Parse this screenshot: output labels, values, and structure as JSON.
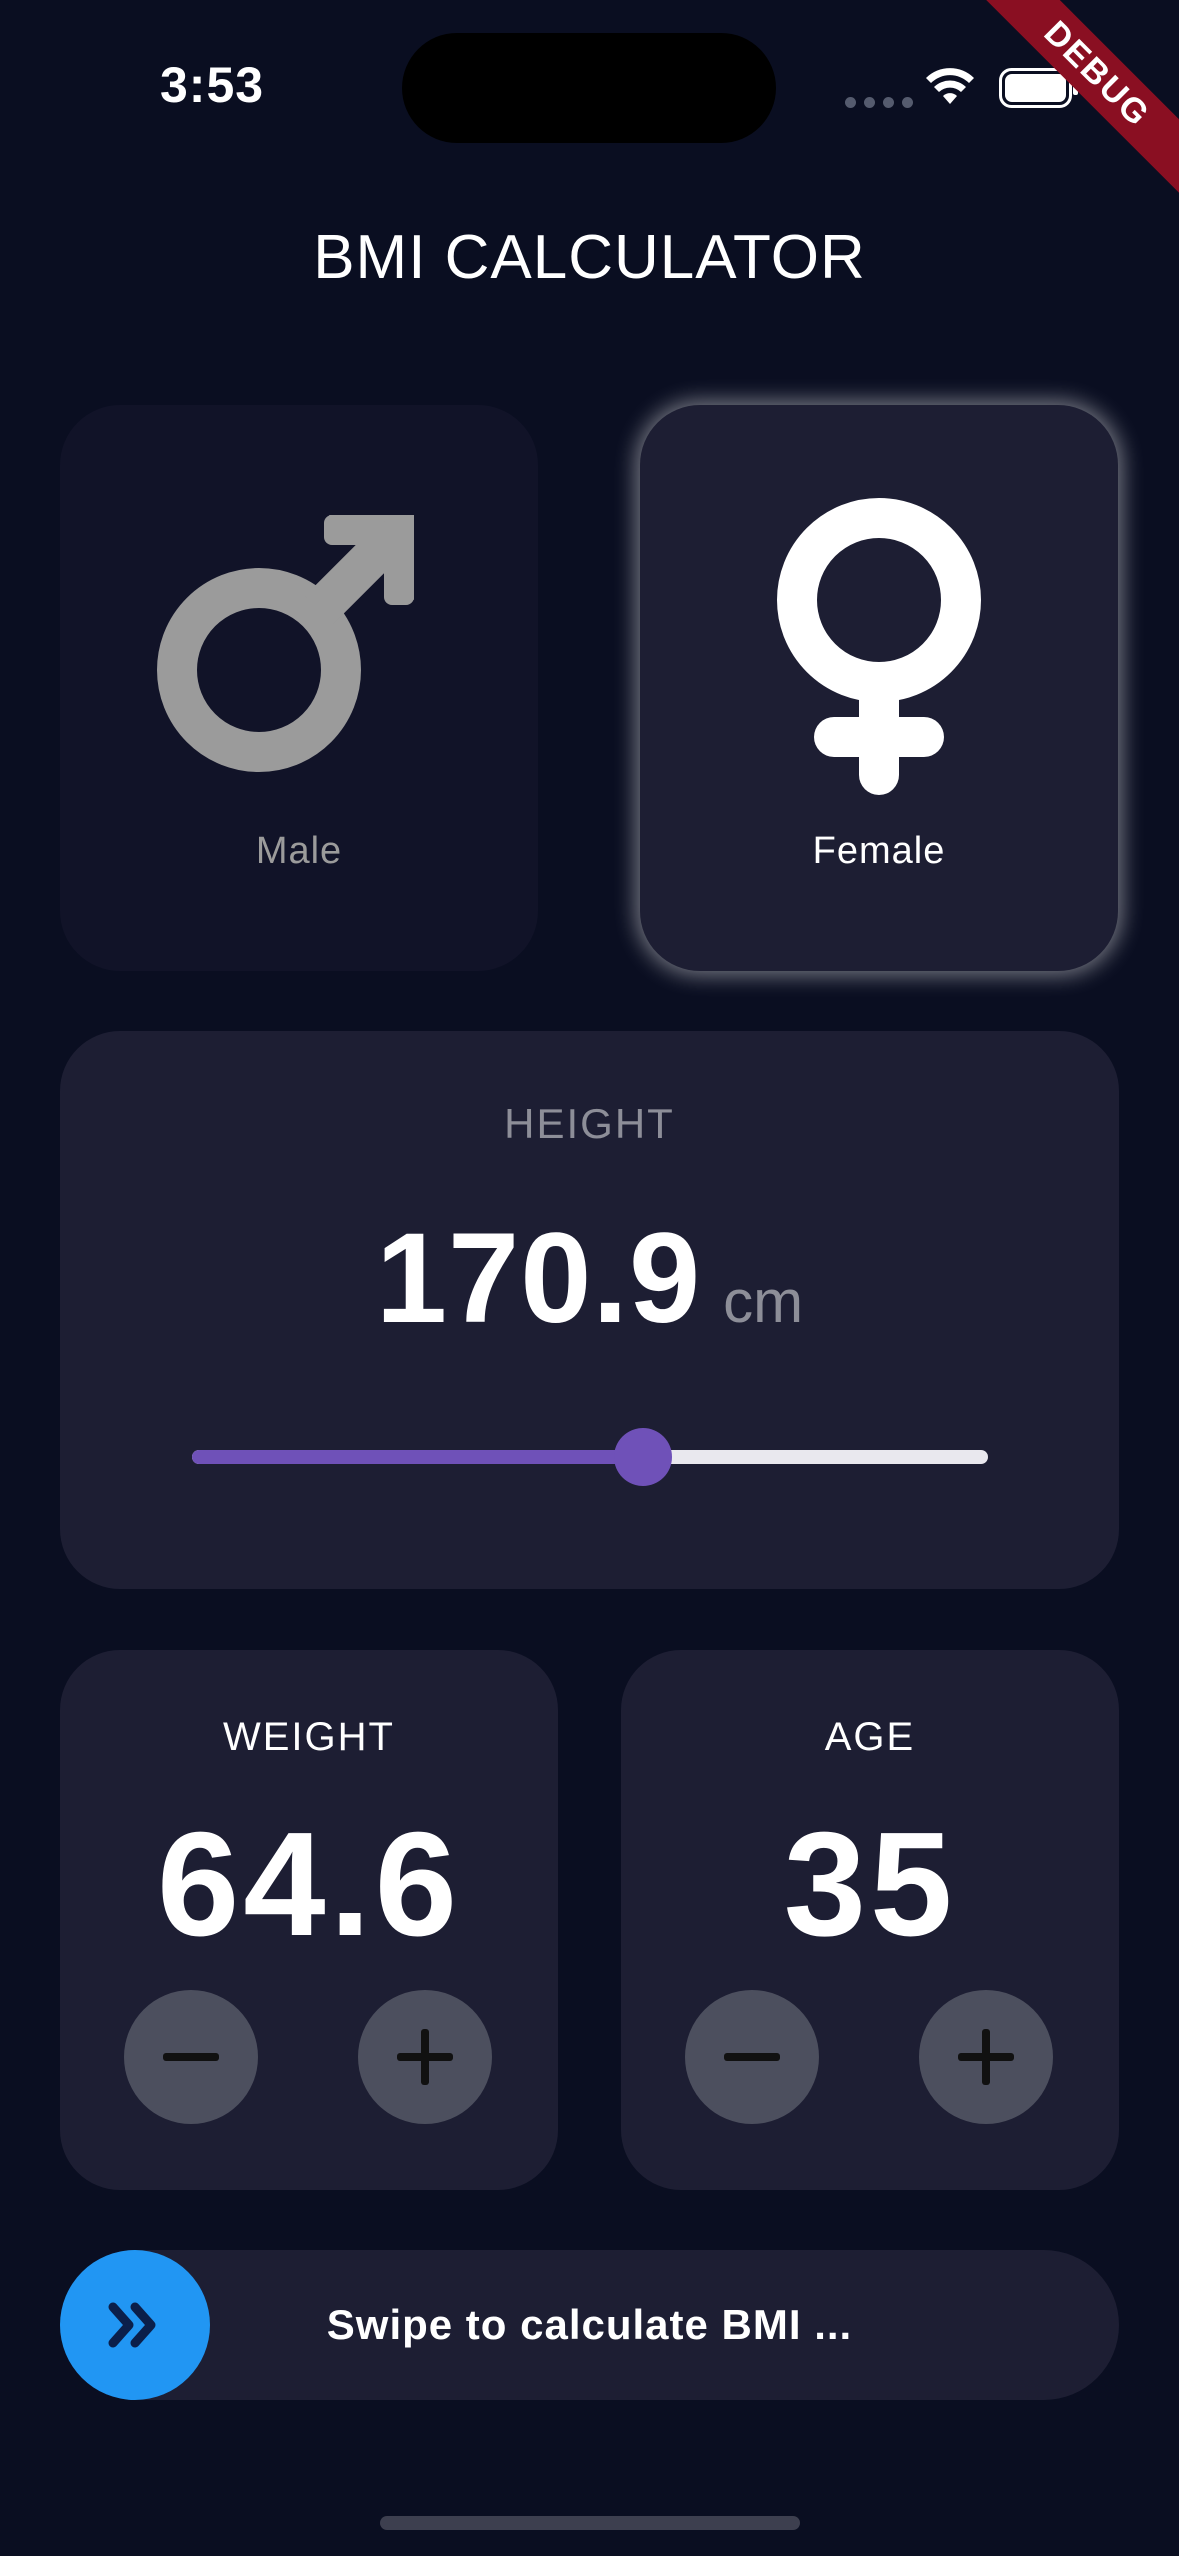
{
  "status_bar": {
    "time": "3:53",
    "wifi_icon": "wifi-icon",
    "battery_icon": "battery-icon"
  },
  "debug_banner": "DEBUG",
  "app_title": "BMI CALCULATOR",
  "gender": {
    "male": {
      "label": "Male",
      "icon": "male-symbol-icon",
      "selected": false,
      "color": "#9b9b9b"
    },
    "female": {
      "label": "Female",
      "icon": "female-symbol-icon",
      "selected": true,
      "color": "#ffffff"
    }
  },
  "height": {
    "label": "HEIGHT",
    "value": "170.9",
    "unit": "cm",
    "slider_fraction": 0.567
  },
  "weight": {
    "label": "WEIGHT",
    "value": "64.6",
    "decrement_icon": "minus-icon",
    "increment_icon": "plus-icon"
  },
  "age": {
    "label": "AGE",
    "value": "35",
    "decrement_icon": "minus-icon",
    "increment_icon": "plus-icon"
  },
  "swipe": {
    "text": "Swipe to calculate BMI ...",
    "icon": "double-chevron-right-icon"
  },
  "colors": {
    "background": "#0a0e21",
    "card": "#1d1e33",
    "card_inactive": "#111328",
    "accent": "#6f51b8",
    "swipe_button": "#2196f3",
    "round_button": "#4c4f5e"
  }
}
